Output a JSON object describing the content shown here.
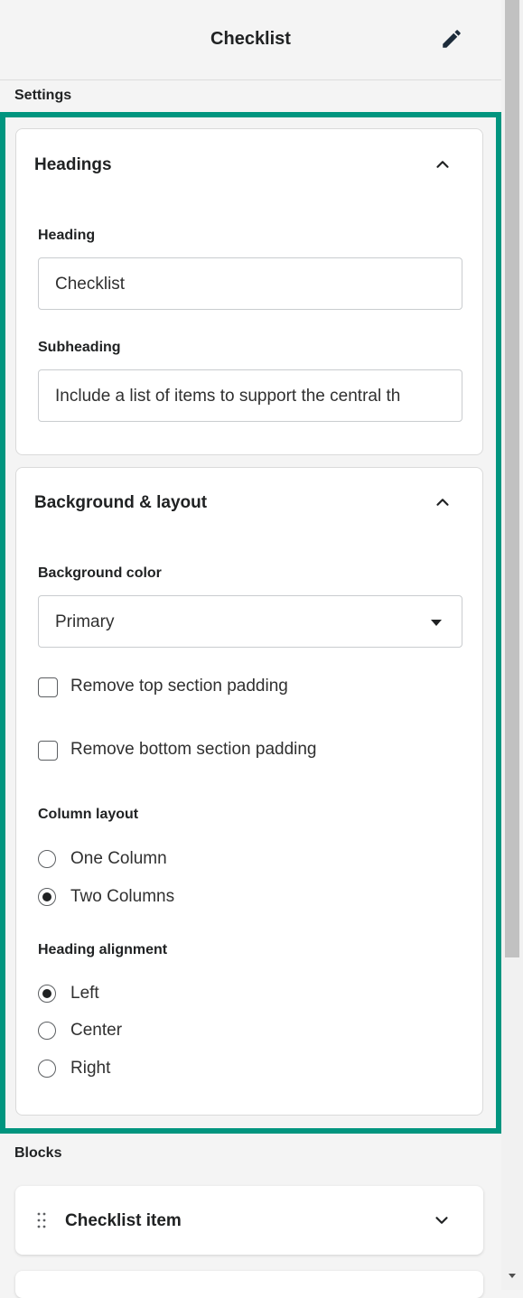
{
  "header": {
    "title": "Checklist",
    "edit_icon": "pencil-icon"
  },
  "settings_label": "Settings",
  "headings_card": {
    "title": "Headings",
    "heading": {
      "label": "Heading",
      "value": "Checklist"
    },
    "subheading": {
      "label": "Subheading",
      "value": "Include a list of items to support the central th"
    }
  },
  "background_card": {
    "title": "Background & layout",
    "background_color": {
      "label": "Background color",
      "value": "Primary"
    },
    "remove_top_padding": {
      "label": "Remove top section padding",
      "checked": false
    },
    "remove_bottom_padding": {
      "label": "Remove bottom section padding",
      "checked": false
    },
    "column_layout": {
      "label": "Column layout",
      "options": [
        "One Column",
        "Two Columns"
      ],
      "selected": "Two Columns"
    },
    "heading_alignment": {
      "label": "Heading alignment",
      "options": [
        "Left",
        "Center",
        "Right"
      ],
      "selected": "Left"
    }
  },
  "blocks_label": "Blocks",
  "blocks": [
    {
      "label": "Checklist item"
    }
  ],
  "colors": {
    "highlight": "#00957f",
    "text": "#202223",
    "background": "#f4f4f4"
  }
}
